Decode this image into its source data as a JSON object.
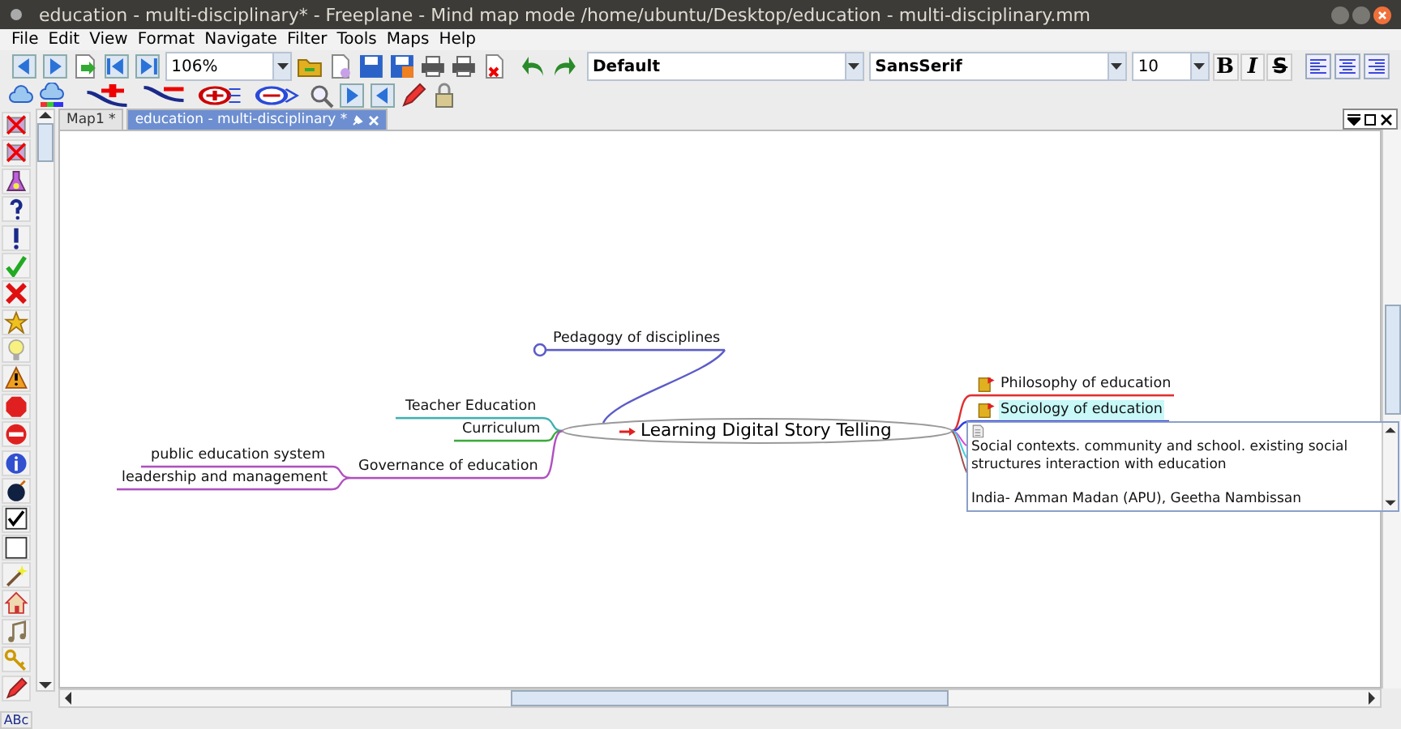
{
  "window": {
    "title": "education - multi-disciplinary* - Freeplane - Mind map mode /home/ubuntu/Desktop/education - multi-disciplinary.mm"
  },
  "menu": [
    "File",
    "Edit",
    "View",
    "Format",
    "Navigate",
    "Filter",
    "Tools",
    "Maps",
    "Help"
  ],
  "toolbar": {
    "zoom": "106%",
    "style": "Default",
    "font": "SansSerif",
    "size": "10",
    "format_buttons": [
      "B",
      "I",
      "S"
    ]
  },
  "tabs": [
    {
      "label": "Map1 *",
      "selected": false
    },
    {
      "label": "education - multi-disciplinary *",
      "selected": true
    }
  ],
  "mind_map": {
    "root": "Learning Digital Story Telling",
    "left": [
      {
        "text": "Pedagogy of disciplines",
        "color": "#5c5cc8",
        "folded": true,
        "selected": false
      },
      {
        "text": "Teacher Education",
        "color": "#40b0b0",
        "folded": false,
        "selected": false
      },
      {
        "text": "Curriculum",
        "color": "#3caa3c",
        "folded": false,
        "selected": false
      },
      {
        "text": "Governance of education",
        "color": "#b050c0",
        "folded": false,
        "selected": false,
        "children": [
          {
            "text": "public  education system",
            "color": "#b050c0",
            "selected": false
          },
          {
            "text": "leadership and management",
            "color": "#b050c0",
            "selected": false
          }
        ]
      }
    ],
    "right": [
      {
        "text": "Philosophy of education",
        "color": "#e03030",
        "selected": false
      },
      {
        "text": "Sociology of education",
        "color": "#3040e0",
        "selected": true
      }
    ]
  },
  "note": [
    "Social contexts. community and school. existing social structures interaction with education",
    "India- Amman Madan (APU), Geetha Nambissan"
  ],
  "spellcheck_label": "ABc"
}
